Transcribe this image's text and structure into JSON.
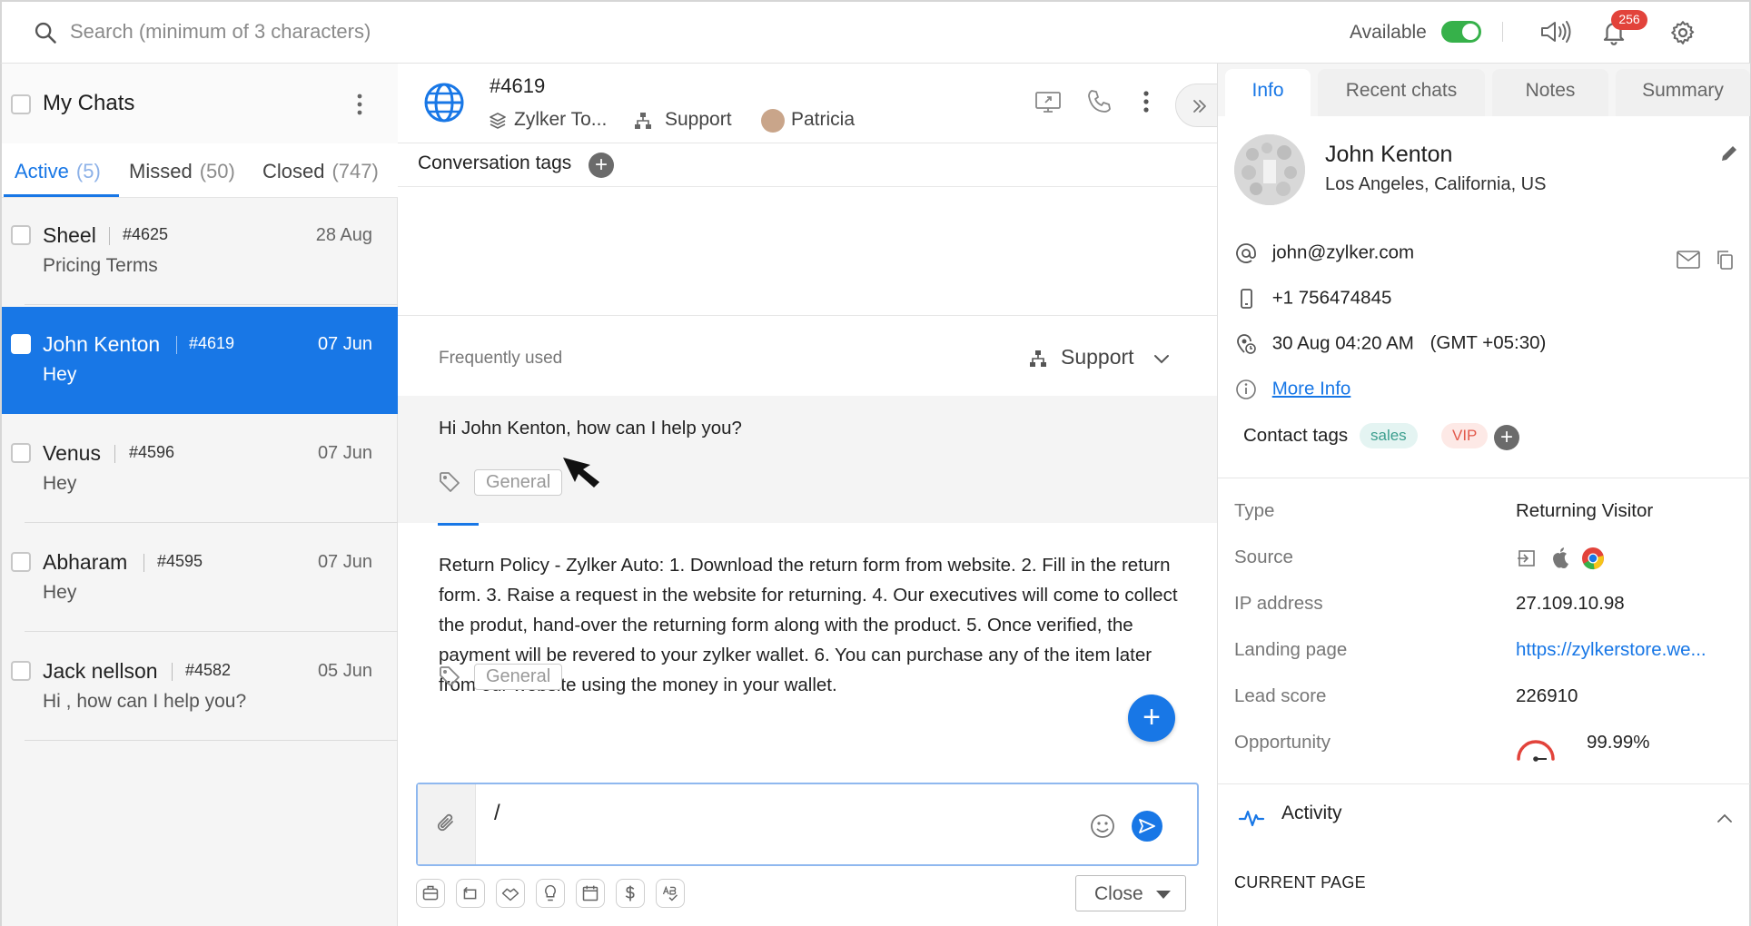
{
  "topbar": {
    "search_placeholder": "Search (minimum of 3 characters)",
    "availability_label": "Available",
    "notification_count": "256"
  },
  "left": {
    "title": "My Chats",
    "tabs": [
      {
        "label": "Active",
        "count": "(5)"
      },
      {
        "label": "Missed",
        "count": "(50)"
      },
      {
        "label": "Closed",
        "count": "(747)"
      }
    ],
    "chats": [
      {
        "name": "Sheel",
        "id": "#4625",
        "date": "28 Aug",
        "message": "Pricing Terms"
      },
      {
        "name": "John Kenton",
        "id": "#4619",
        "date": "07 Jun",
        "message": "Hey"
      },
      {
        "name": "Venus",
        "id": "#4596",
        "date": "07 Jun",
        "message": "Hey"
      },
      {
        "name": "Abharam",
        "id": "#4595",
        "date": "07 Jun",
        "message": "Hey"
      },
      {
        "name": "Jack nellson",
        "id": "#4582",
        "date": "05 Jun",
        "message": "Hi , how can I help you?"
      }
    ]
  },
  "conversation": {
    "id": "#4619",
    "brand": "Zylker To...",
    "department": "Support",
    "agent": "Patricia",
    "tags_label": "Conversation tags"
  },
  "canned": {
    "frequently_used": "Frequently used",
    "department": "Support",
    "responses": [
      {
        "text": "Hi John Kenton, how can I help you?",
        "tag": "General"
      },
      {
        "text": "Return Policy - Zylker Auto: 1. Download the return form from website. 2. Fill in the return form. 3. Raise a request in the website for returning. 4. Our executives will come to collect the produt, hand-over the returning form along with the product. 5. Once verified, the payment will be revered to your zylker wallet. 6. You can purchase any of the item later from our website using the money in your wallet.",
        "tag": "General"
      }
    ]
  },
  "composer": {
    "text": "/",
    "close_label": "Close"
  },
  "right": {
    "tabs": [
      "Info",
      "Recent chats",
      "Notes",
      "Summary"
    ],
    "name": "John Kenton",
    "location": "Los Angeles, California, US",
    "email": "john@zylker.com",
    "phone": "+1 756474845",
    "local_time": "30 Aug 04:20 AM",
    "timezone": "(GMT +05:30)",
    "more_info": "More Info",
    "contact_tags_label": "Contact tags",
    "contact_tags": [
      "sales",
      "VIP"
    ],
    "details": [
      {
        "label": "Type",
        "value": "Returning Visitor"
      },
      {
        "label": "Source",
        "value": ""
      },
      {
        "label": "IP address",
        "value": "27.109.10.98"
      },
      {
        "label": "Landing page",
        "value": "https://zylkerstore.we..."
      },
      {
        "label": "Lead score",
        "value": "226910"
      },
      {
        "label": "Opportunity",
        "value": "99.99%"
      }
    ],
    "opportunity_fraction": 0.9999,
    "activity_label": "Activity",
    "current_page_label": "CURRENT PAGE"
  },
  "colors": {
    "accent": "#1877e6",
    "available_green": "#36b14a",
    "badge_red": "#e2433b"
  }
}
